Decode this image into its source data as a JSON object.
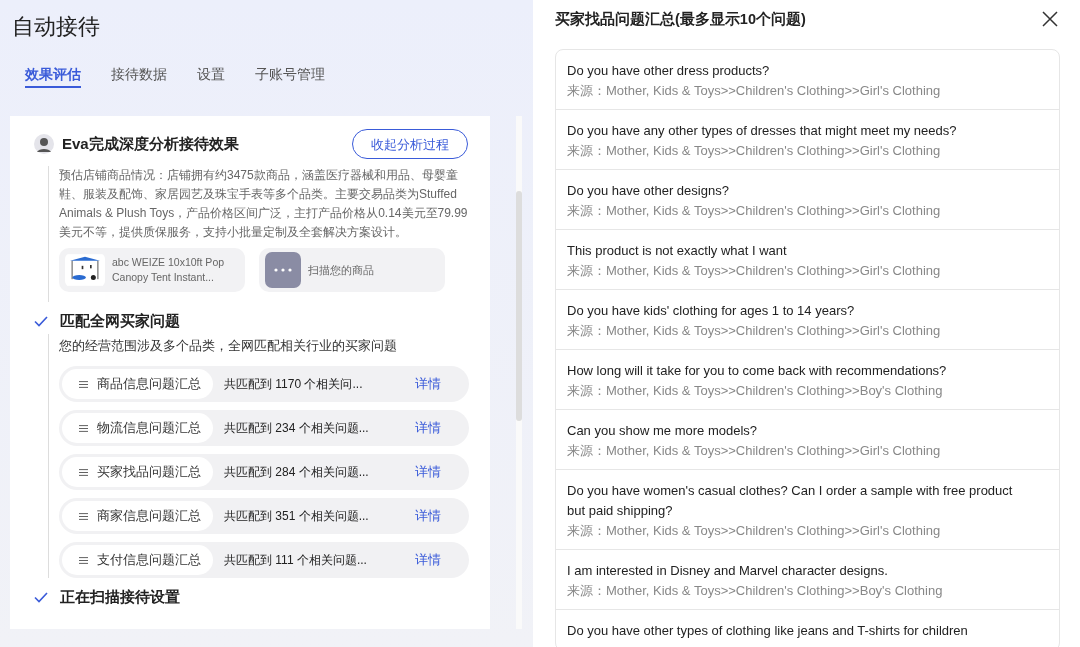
{
  "page": {
    "title": "自动接待"
  },
  "tabs": [
    {
      "label": "效果评估",
      "selected": true
    },
    {
      "label": "接待数据",
      "selected": false
    },
    {
      "label": "设置",
      "selected": false
    },
    {
      "label": "子账号管理",
      "selected": false
    }
  ],
  "analysis": {
    "title": "Eva完成深度分析接待效果",
    "collapse_button": "收起分析过程",
    "summary": "预估店铺商品情况：店铺拥有约3475款商品，涵盖医疗器械和用品、母婴童鞋、服装及配饰、家居园艺及珠宝手表等多个品类。主要交易品类为Stuffed Animals & Plush Toys，产品价格区间广泛，主打产品价格从0.14美元至79.99美元不等，提供质保服务，支持小批量定制及全套解决方案设计。",
    "products": [
      {
        "kind": "product",
        "name": "abc WEIZE 10x10ft Pop Canopy Tent Instant..."
      },
      {
        "kind": "scan",
        "name": "扫描您的商品"
      }
    ],
    "steps": [
      {
        "title": "匹配全网买家问题",
        "done": true,
        "note": "您的经营范围涉及多个品类，全网匹配相关行业的买家问题",
        "groups": [
          {
            "name": "商品信息问题汇总",
            "count": "共匹配到 1170 个相关问...",
            "link": "详情"
          },
          {
            "name": "物流信息问题汇总",
            "count": "共匹配到 234 个相关问题...",
            "link": "详情"
          },
          {
            "name": "买家找品问题汇总",
            "count": "共匹配到 284 个相关问题...",
            "link": "详情"
          },
          {
            "name": "商家信息问题汇总",
            "count": "共匹配到 351 个相关问题...",
            "link": "详情"
          },
          {
            "name": "支付信息问题汇总",
            "count": "共匹配到 111 个相关问题...",
            "link": "详情"
          }
        ]
      },
      {
        "title": "正在扫描接待设置",
        "done": true
      }
    ]
  },
  "drawer": {
    "title": "买家找品问题汇总(最多显示10个问题)",
    "questions": [
      {
        "question": "Do you have other dress products?",
        "source": "来源：Mother, Kids & Toys>>Children's Clothing>>Girl's Clothing"
      },
      {
        "question": "Do you have any other types of dresses that might meet my needs?",
        "source": "来源：Mother, Kids & Toys>>Children's Clothing>>Girl's Clothing"
      },
      {
        "question": "Do you have other designs?",
        "source": "来源：Mother, Kids & Toys>>Children's Clothing>>Girl's Clothing"
      },
      {
        "question": "This product is not exactly what I want",
        "source": "来源：Mother, Kids & Toys>>Children's Clothing>>Girl's Clothing"
      },
      {
        "question": "Do you have kids' clothing for ages 1 to 14 years?",
        "source": "来源：Mother, Kids & Toys>>Children's Clothing>>Girl's Clothing"
      },
      {
        "question": "How long will it take for you to come back with recommendations?",
        "source": "来源：Mother, Kids & Toys>>Children's Clothing>>Boy's Clothing"
      },
      {
        "question": "Can you show me more models?",
        "source": "来源：Mother, Kids & Toys>>Children's Clothing>>Girl's Clothing"
      },
      {
        "question": "Do you have women's casual clothes? Can I order a sample with free product but paid shipping?",
        "source": "来源：Mother, Kids & Toys>>Children's Clothing>>Girl's Clothing"
      },
      {
        "question": "I am interested in Disney and Marvel character designs.",
        "source": "来源：Mother, Kids & Toys>>Children's Clothing>>Boy's Clothing"
      },
      {
        "question": "Do you have other types of clothing like jeans and T-shirts for children"
      }
    ]
  }
}
